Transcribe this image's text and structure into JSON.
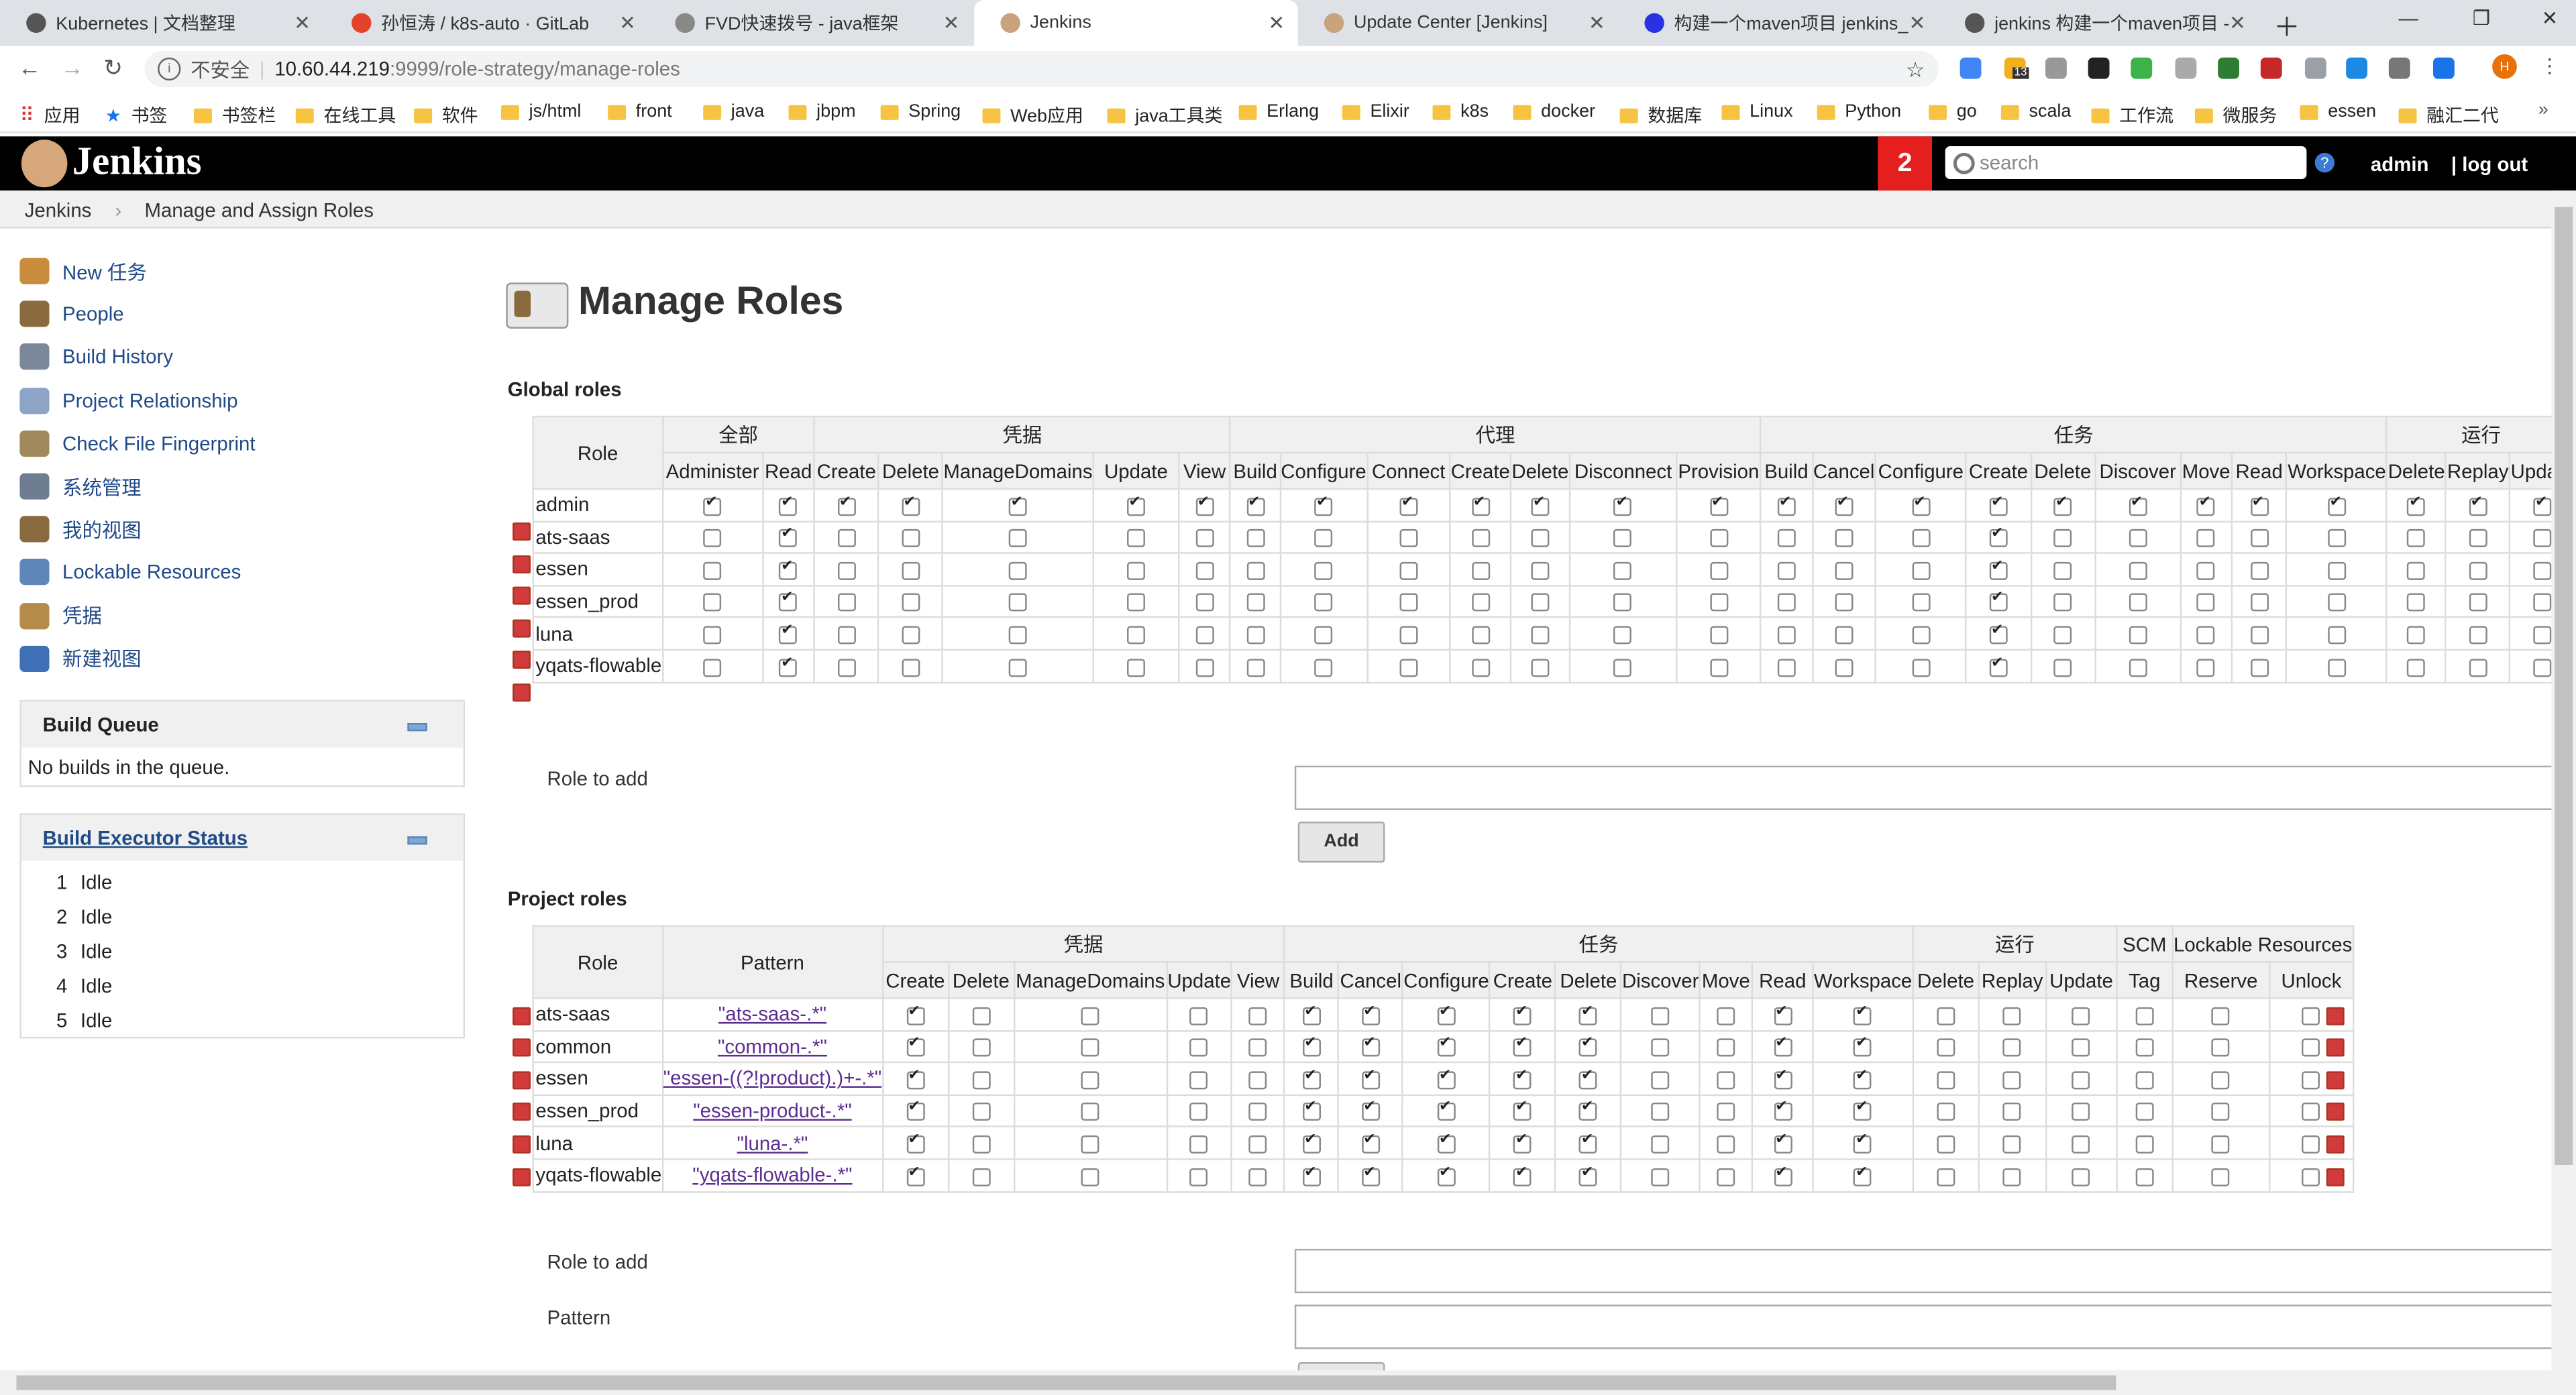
{
  "browser": {
    "tabs": [
      {
        "title": "Kubernetes | 文档整理",
        "color": "#555"
      },
      {
        "title": "孙恒涛 / k8s-auto · GitLab",
        "color": "#e24329"
      },
      {
        "title": "FVD快速拨号 - java框架",
        "color": "#888"
      },
      {
        "title": "Jenkins",
        "color": "#c9a27e"
      },
      {
        "title": "Update Center [Jenkins]",
        "color": "#c9a27e"
      },
      {
        "title": "构建一个maven项目 jenkins_百...",
        "color": "#2932e1"
      },
      {
        "title": "jenkins 构建一个maven项目 - ...",
        "color": "#555"
      }
    ],
    "address": {
      "insecure_label": "不安全",
      "host": "10.60.44.219",
      "path": ":9999/role-strategy/manage-roles"
    },
    "profile_initial": "H",
    "ext_badge": "13",
    "bookmarks": [
      "应用",
      "书签",
      "书签栏",
      "在线工具",
      "软件",
      "js/html",
      "front",
      "java",
      "jbpm",
      "Spring",
      "Web应用",
      "java工具类",
      "Erlang",
      "Elixir",
      "k8s",
      "docker",
      "数据库",
      "Linux",
      "Python",
      "go",
      "scala",
      "工作流",
      "微服务",
      "essen",
      "融汇二代"
    ]
  },
  "header": {
    "title": "Jenkins",
    "badge": "2",
    "search_placeholder": "search",
    "user": "admin",
    "logout": "| log out"
  },
  "breadcrumbs": [
    "Jenkins",
    "Manage and Assign Roles"
  ],
  "tasks": [
    {
      "label": "New 任务",
      "icon": "new-item-icon",
      "color": "#c98c3c"
    },
    {
      "label": "People",
      "icon": "people-icon",
      "color": "#8a6a3f"
    },
    {
      "label": "Build History",
      "icon": "build-history-icon",
      "color": "#7a8899"
    },
    {
      "label": "Project Relationship",
      "icon": "search-icon",
      "color": "#8ea4c6"
    },
    {
      "label": "Check File Fingerprint",
      "icon": "fingerprint-icon",
      "color": "#a0895c"
    },
    {
      "label": "系统管理",
      "icon": "gear-icon",
      "color": "#6f7d91"
    },
    {
      "label": "我的视图",
      "icon": "my-views-icon",
      "color": "#8a6a3f"
    },
    {
      "label": "Lockable Resources",
      "icon": "lockable-resources-icon",
      "color": "#5e86b8"
    },
    {
      "label": "凭据",
      "icon": "credentials-icon",
      "color": "#b58b4a"
    },
    {
      "label": "新建视图",
      "icon": "new-view-icon",
      "color": "#3f6fb5"
    }
  ],
  "build_queue": {
    "title": "Build Queue",
    "empty": "No builds in the queue."
  },
  "executors": {
    "title": "Build Executor Status",
    "items": [
      {
        "num": "1",
        "status": "Idle"
      },
      {
        "num": "2",
        "status": "Idle"
      },
      {
        "num": "3",
        "status": "Idle"
      },
      {
        "num": "4",
        "status": "Idle"
      },
      {
        "num": "5",
        "status": "Idle"
      }
    ]
  },
  "page_title": "Manage Roles",
  "global": {
    "section_title": "Global roles",
    "role_header": "Role",
    "groups": [
      {
        "label": "全部",
        "perms": [
          "Administer",
          "Read"
        ]
      },
      {
        "label": "凭据",
        "perms": [
          "Create",
          "Delete",
          "ManageDomains",
          "Update",
          "View"
        ]
      },
      {
        "label": "代理",
        "perms": [
          "Build",
          "Configure",
          "Connect",
          "Create",
          "Delete",
          "Disconnect",
          "Provision"
        ]
      },
      {
        "label": "任务",
        "perms": [
          "Build",
          "Cancel",
          "Configure",
          "Create",
          "Delete",
          "Discover",
          "Move",
          "Read",
          "Workspace"
        ]
      },
      {
        "label": "运行",
        "perms": [
          "Delete",
          "Replay",
          "Update"
        ]
      }
    ],
    "rows": [
      {
        "name": "admin",
        "checks": [
          1,
          1,
          1,
          1,
          1,
          1,
          1,
          1,
          1,
          1,
          1,
          1,
          1,
          1,
          1,
          1,
          1,
          1,
          1,
          1,
          1,
          1,
          1,
          1,
          1,
          1
        ]
      },
      {
        "name": "ats-saas",
        "checks": [
          0,
          1,
          0,
          0,
          0,
          0,
          0,
          0,
          0,
          0,
          0,
          0,
          0,
          0,
          0,
          0,
          0,
          1,
          0,
          0,
          0,
          0,
          0,
          0,
          0,
          0
        ]
      },
      {
        "name": "essen",
        "checks": [
          0,
          1,
          0,
          0,
          0,
          0,
          0,
          0,
          0,
          0,
          0,
          0,
          0,
          0,
          0,
          0,
          0,
          1,
          0,
          0,
          0,
          0,
          0,
          0,
          0,
          0
        ]
      },
      {
        "name": "essen_prod",
        "checks": [
          0,
          1,
          0,
          0,
          0,
          0,
          0,
          0,
          0,
          0,
          0,
          0,
          0,
          0,
          0,
          0,
          0,
          1,
          0,
          0,
          0,
          0,
          0,
          0,
          0,
          0
        ]
      },
      {
        "name": "luna",
        "checks": [
          0,
          1,
          0,
          0,
          0,
          0,
          0,
          0,
          0,
          0,
          0,
          0,
          0,
          0,
          0,
          0,
          0,
          1,
          0,
          0,
          0,
          0,
          0,
          0,
          0,
          0
        ]
      },
      {
        "name": "yqats-flowable",
        "checks": [
          0,
          1,
          0,
          0,
          0,
          0,
          0,
          0,
          0,
          0,
          0,
          0,
          0,
          0,
          0,
          0,
          0,
          1,
          0,
          0,
          0,
          0,
          0,
          0,
          0,
          0
        ]
      }
    ],
    "role_to_add_label": "Role to add",
    "role_to_add_value": "",
    "add_button": "Add"
  },
  "project": {
    "section_title": "Project roles",
    "role_header": "Role",
    "pattern_header": "Pattern",
    "groups": [
      {
        "label": "凭据",
        "perms": [
          "Create",
          "Delete",
          "ManageDomains",
          "Update",
          "View"
        ]
      },
      {
        "label": "任务",
        "perms": [
          "Build",
          "Cancel",
          "Configure",
          "Create",
          "Delete",
          "Discover",
          "Move",
          "Read",
          "Workspace"
        ]
      },
      {
        "label": "运行",
        "perms": [
          "Delete",
          "Replay",
          "Update"
        ]
      },
      {
        "label": "SCM",
        "perms": [
          "Tag"
        ]
      },
      {
        "label": "Lockable Resources",
        "perms": [
          "Reserve",
          "Unlock"
        ]
      }
    ],
    "rows": [
      {
        "name": "ats-saas",
        "pattern": "\"ats-saas-.*\"",
        "checks": [
          1,
          0,
          0,
          0,
          0,
          1,
          1,
          1,
          1,
          1,
          0,
          0,
          1,
          1,
          0,
          0,
          0,
          0,
          0,
          0
        ]
      },
      {
        "name": "common",
        "pattern": "\"common-.*\"",
        "checks": [
          1,
          0,
          0,
          0,
          0,
          1,
          1,
          1,
          1,
          1,
          0,
          0,
          1,
          1,
          0,
          0,
          0,
          0,
          0,
          0
        ]
      },
      {
        "name": "essen",
        "pattern": "\"essen-((?!product).)+-.*\"",
        "checks": [
          1,
          0,
          0,
          0,
          0,
          1,
          1,
          1,
          1,
          1,
          0,
          0,
          1,
          1,
          0,
          0,
          0,
          0,
          0,
          0
        ]
      },
      {
        "name": "essen_prod",
        "pattern": "\"essen-product-.*\"",
        "checks": [
          1,
          0,
          0,
          0,
          0,
          1,
          1,
          1,
          1,
          1,
          0,
          0,
          1,
          1,
          0,
          0,
          0,
          0,
          0,
          0
        ]
      },
      {
        "name": "luna",
        "pattern": "\"luna-.*\"",
        "checks": [
          1,
          0,
          0,
          0,
          0,
          1,
          1,
          1,
          1,
          1,
          0,
          0,
          1,
          1,
          0,
          0,
          0,
          0,
          0,
          0
        ]
      },
      {
        "name": "yqats-flowable",
        "pattern": "\"yqats-flowable-.*\"",
        "checks": [
          1,
          0,
          0,
          0,
          0,
          1,
          1,
          1,
          1,
          1,
          0,
          0,
          1,
          1,
          0,
          0,
          0,
          0,
          0,
          0
        ]
      }
    ],
    "role_to_add_label": "Role to add",
    "role_to_add_value": "",
    "pattern_label": "Pattern",
    "pattern_value": ""
  }
}
